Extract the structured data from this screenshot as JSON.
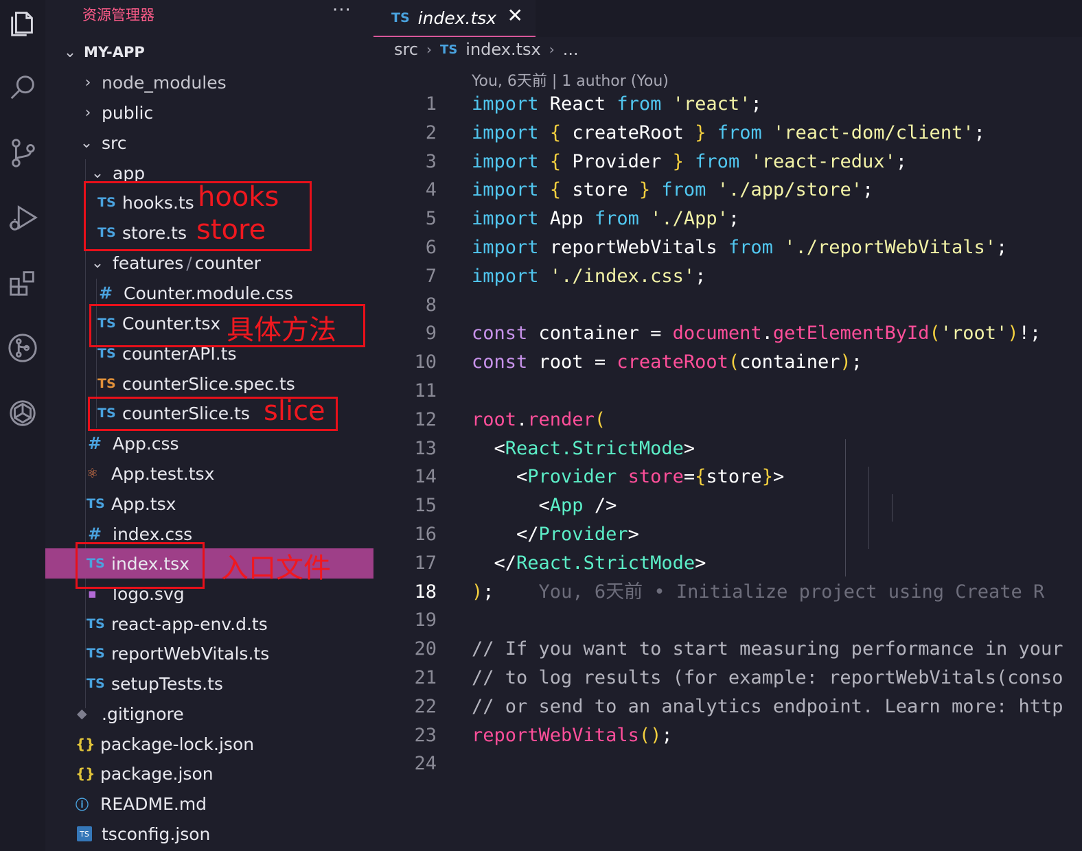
{
  "activity_bar": {
    "items": [
      "explorer-icon",
      "search-icon",
      "source-control-icon",
      "run-debug-icon",
      "extensions-icon",
      "git-graph-icon",
      "openai-icon"
    ]
  },
  "sidebar": {
    "title": "资源管理器",
    "more": "···",
    "project": "MY-APP",
    "tree": [
      {
        "label": "node_modules",
        "kind": "folder",
        "expanded": false
      },
      {
        "label": "public",
        "kind": "folder",
        "expanded": false
      },
      {
        "label": "src",
        "kind": "folder",
        "expanded": true
      },
      {
        "label": "app",
        "kind": "folder",
        "expanded": true
      },
      {
        "label": "hooks.ts",
        "kind": "ts"
      },
      {
        "label": "store.ts",
        "kind": "ts"
      },
      {
        "label_a": "features",
        "label_b": "counter",
        "kind": "folder",
        "expanded": true
      },
      {
        "label": "Counter.module.css",
        "kind": "css"
      },
      {
        "label": "Counter.tsx",
        "kind": "ts"
      },
      {
        "label": "counterAPI.ts",
        "kind": "ts"
      },
      {
        "label": "counterSlice.spec.ts",
        "kind": "ts-test"
      },
      {
        "label": "counterSlice.ts",
        "kind": "ts"
      },
      {
        "label": "App.css",
        "kind": "css"
      },
      {
        "label": "App.test.tsx",
        "kind": "react"
      },
      {
        "label": "App.tsx",
        "kind": "ts"
      },
      {
        "label": "index.css",
        "kind": "css"
      },
      {
        "label": "index.tsx",
        "kind": "ts",
        "selected": true
      },
      {
        "label": "logo.svg",
        "kind": "svg"
      },
      {
        "label": "react-app-env.d.ts",
        "kind": "ts"
      },
      {
        "label": "reportWebVitals.ts",
        "kind": "ts"
      },
      {
        "label": "setupTests.ts",
        "kind": "ts"
      },
      {
        "label": ".gitignore",
        "kind": "git"
      },
      {
        "label": "package-lock.json",
        "kind": "json"
      },
      {
        "label": "package.json",
        "kind": "json"
      },
      {
        "label": "README.md",
        "kind": "info"
      },
      {
        "label": "tsconfig.json",
        "kind": "tsconfig"
      }
    ],
    "ts_badge": "TS",
    "css_badge": "#",
    "json_badge": "{}",
    "info_badge": "i",
    "annotations": [
      "hooks",
      "store",
      "具体方法",
      "slice",
      "入口文件"
    ]
  },
  "editor": {
    "tab": {
      "badge": "TS",
      "label": "index.tsx",
      "close": "✕"
    },
    "breadcrumb": {
      "a": "src",
      "b": "index.tsx",
      "c": "..."
    },
    "blame_header": "You, 6天前 | 1 author (You)",
    "current_line": 18,
    "inline_blame": "You, 6天前 • Initialize project using Create R",
    "lines": [
      "import React from 'react';",
      "import { createRoot } from 'react-dom/client';",
      "import { Provider } from 'react-redux';",
      "import { store } from './app/store';",
      "import App from './App';",
      "import reportWebVitals from './reportWebVitals';",
      "import './index.css';",
      "",
      "const container = document.getElementById('root')!;",
      "const root = createRoot(container);",
      "",
      "root.render(",
      "  <React.StrictMode>",
      "    <Provider store={store}>",
      "      <App />",
      "    </Provider>",
      "  </React.StrictMode>",
      ");",
      "",
      "// If you want to start measuring performance in your",
      "// to log results (for example: reportWebVitals(conso",
      "// or send to an analytics endpoint. Learn more: http",
      "reportWebVitals();",
      ""
    ]
  }
}
